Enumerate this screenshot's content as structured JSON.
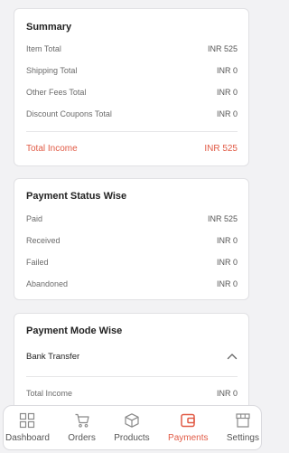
{
  "summary": {
    "title": "Summary",
    "rows": [
      {
        "label": "Item Total",
        "value": "INR 525"
      },
      {
        "label": "Shipping Total",
        "value": "INR 0"
      },
      {
        "label": "Other Fees Total",
        "value": "INR 0"
      },
      {
        "label": "Discount Coupons Total",
        "value": "INR 0"
      }
    ],
    "total": {
      "label": "Total Income",
      "value": "INR 525"
    }
  },
  "status": {
    "title": "Payment Status Wise",
    "rows": [
      {
        "label": "Paid",
        "value": "INR 525"
      },
      {
        "label": "Received",
        "value": "INR 0"
      },
      {
        "label": "Failed",
        "value": "INR 0"
      },
      {
        "label": "Abandoned",
        "value": "INR 0"
      }
    ]
  },
  "mode": {
    "title": "Payment Mode Wise",
    "accordion_label": "Bank Transfer",
    "rows": [
      {
        "label": "Total Income",
        "value": "INR 0"
      }
    ]
  },
  "nav": {
    "items": [
      {
        "label": "Dashboard",
        "icon": "grid-icon"
      },
      {
        "label": "Orders",
        "icon": "cart-icon"
      },
      {
        "label": "Products",
        "icon": "box-icon"
      },
      {
        "label": "Payments",
        "icon": "wallet-icon"
      },
      {
        "label": "Settings",
        "icon": "store-icon"
      }
    ],
    "active": "Payments"
  },
  "colors": {
    "accent": "#e15a45",
    "background": "#f2f2f4"
  }
}
